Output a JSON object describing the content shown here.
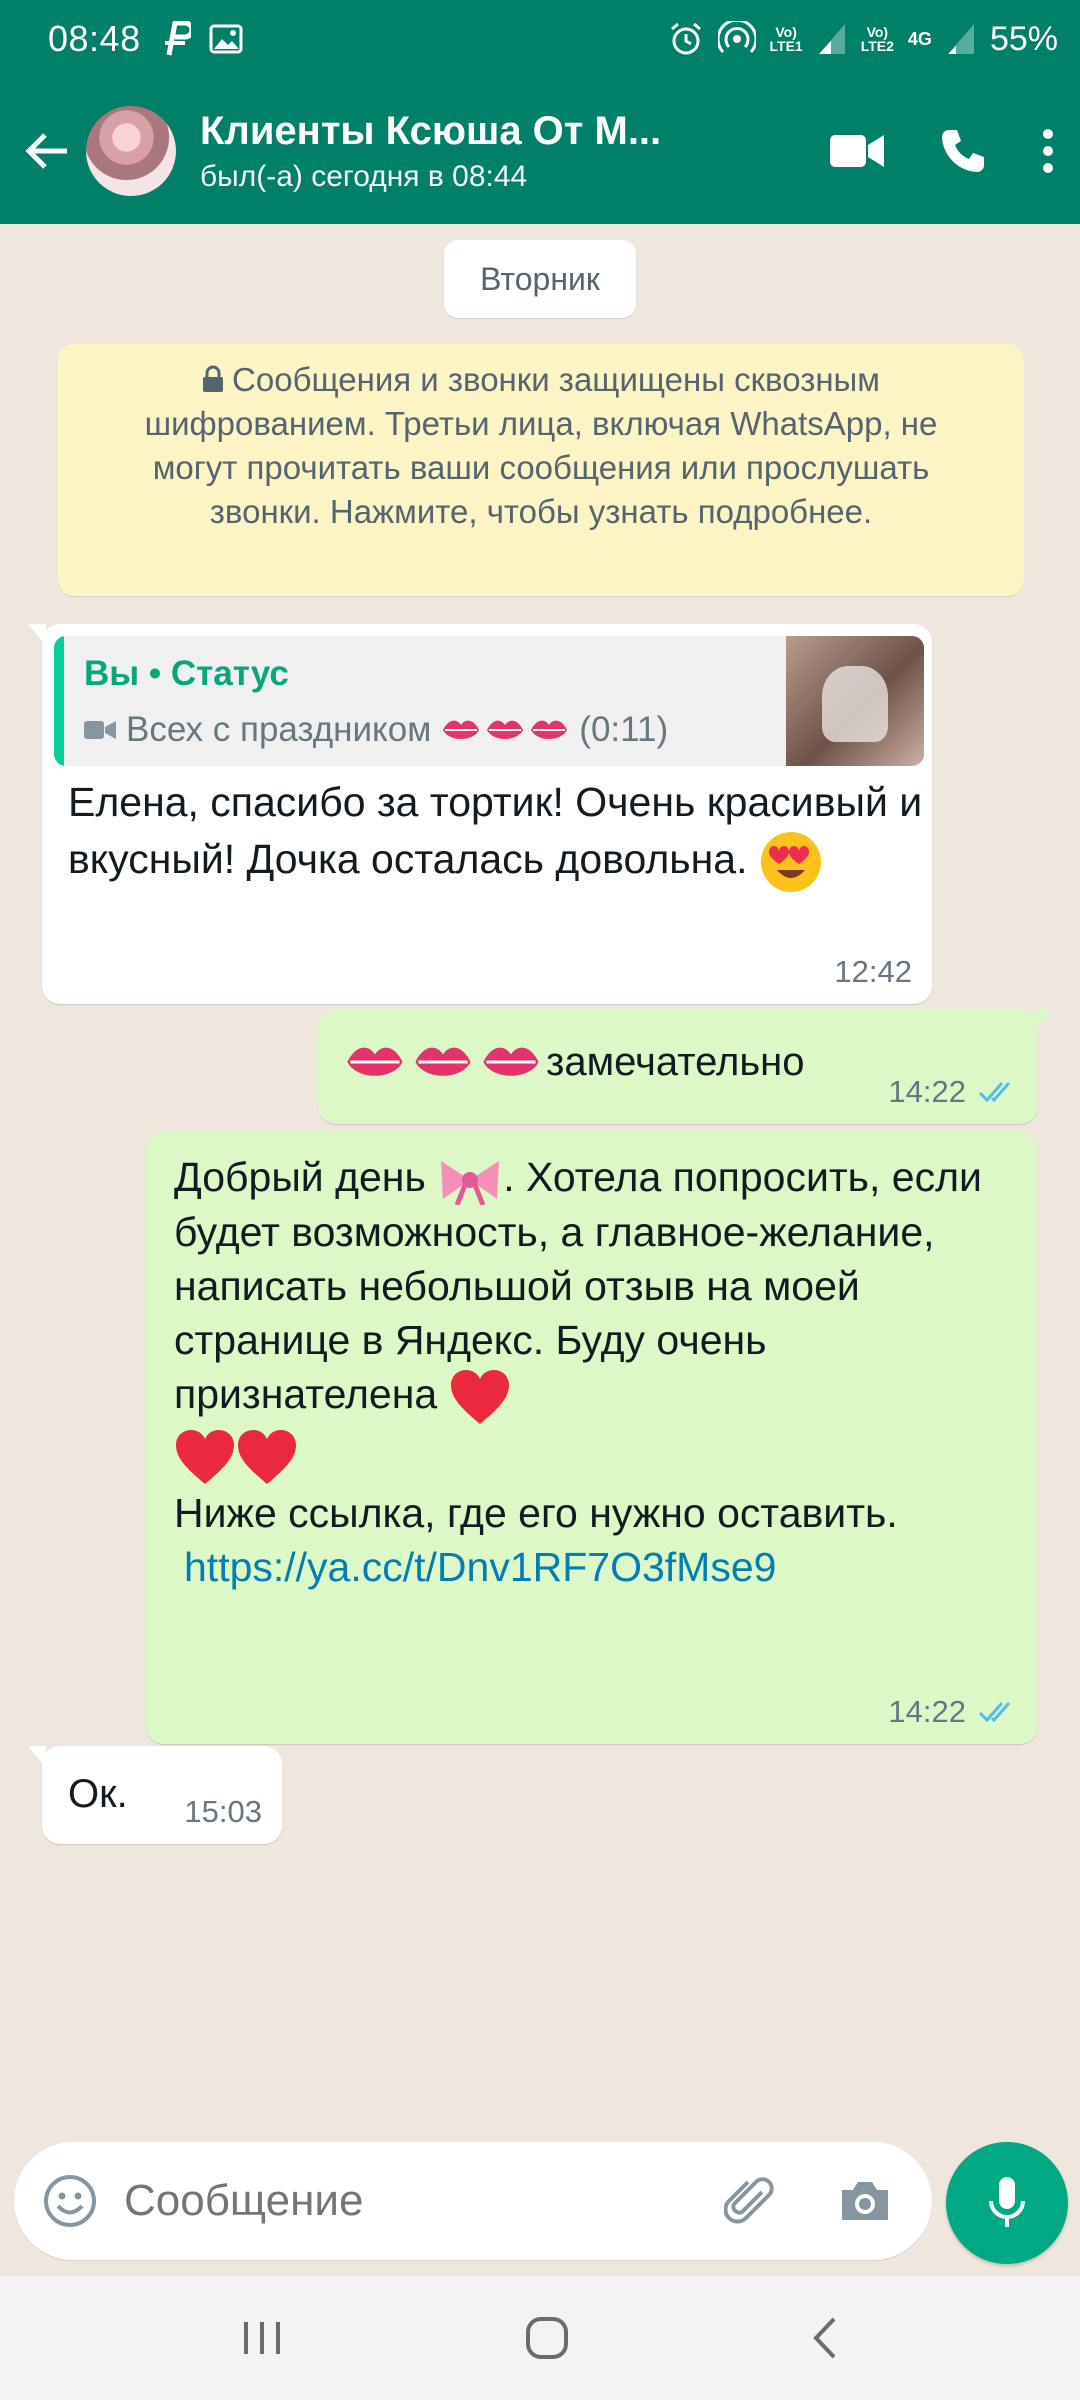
{
  "status_bar": {
    "time": "08:48",
    "net1": "Vo)\nLTE1",
    "net2": "Vo)\nLTE2",
    "net_type": "4G",
    "battery": "55%"
  },
  "header": {
    "title": "Клиенты Ксюша От М...",
    "subtitle": "был(-а) сегодня в 08:44"
  },
  "date_chip": "Вторник",
  "encryption_notice": "Сообщения и звонки защищены сквозным шифрованием. Третьи лица, включая WhatsApp, не могут прочитать ваши сообщения или прослушать звонки. Нажмите, чтобы узнать подробнее.",
  "messages": [
    {
      "direction": "in",
      "quote_author": "Вы • Статус",
      "quote_text": "Всех с праздником",
      "quote_duration": "(0:11)",
      "text": "Елена, спасибо за  тортик! Очень красивый и вкусный! Дочка осталась довольна.",
      "time": "12:42"
    },
    {
      "direction": "out",
      "text": "замечательно",
      "time": "14:22",
      "status": "read"
    },
    {
      "direction": "out",
      "text_1": "Добрый день",
      "text_2": ".  Хотела попросить, если будет возможность,  а главное-желание,  написать небольшой отзыв на моей странице в Яндекс.  Буду очень признателена",
      "text_3": "Ниже ссылка, где его нужно оставить.",
      "link": "https://ya.cc/t/Dnv1RF7O3fMse9",
      "time": "14:22",
      "status": "read"
    },
    {
      "direction": "in",
      "text": "Ок.",
      "time": "15:03"
    }
  ],
  "composer": {
    "placeholder": "Сообщение"
  },
  "colors": {
    "header": "#008069",
    "out_bubble": "#dcf8c6",
    "in_bubble": "#ffffff",
    "read_ticks": "#53bdeb",
    "mic_button": "#00a884"
  }
}
